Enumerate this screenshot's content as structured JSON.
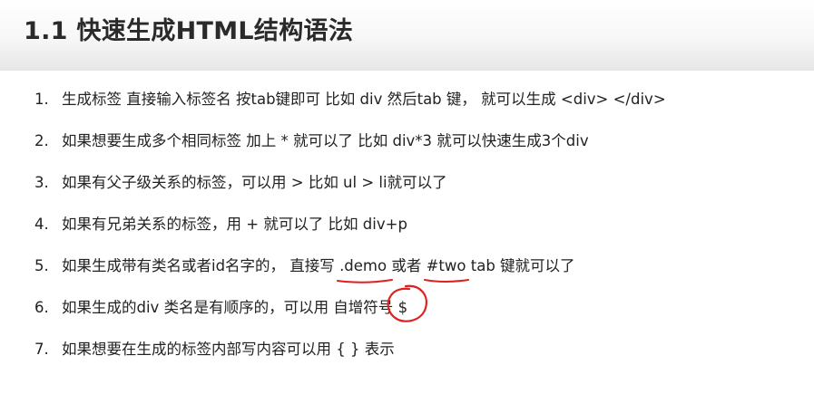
{
  "title": "1.1 快速生成HTML结构语法",
  "items": [
    {
      "num": "1.",
      "text": "生成标签 直接输入标签名 按tab键即可   比如  div   然后tab 键， 就可以生成 <div> </div>"
    },
    {
      "num": "2.",
      "text": "如果想要生成多个相同标签  加上 * 就可以了 比如   div*3  就可以快速生成3个div"
    },
    {
      "num": "3.",
      "text": "如果有父子级关系的标签，可以用 >  比如   ul > li就可以了"
    },
    {
      "num": "4.",
      "text": "如果有兄弟关系的标签，用  +  就可以了 比如 div+p"
    },
    {
      "num": "5.",
      "text_before": "如果生成带有类名或者id名字的，  直接写 ",
      "mark1": ".demo",
      "text_middle": "  或者  ",
      "mark2": "#two",
      "text_after": "  tab 键就可以了"
    },
    {
      "num": "6.",
      "text_before": "如果生成的div 类名是有顺序的，可以用 自增符号 ",
      "mark": "$"
    },
    {
      "num": "7.",
      "text": "如果想要在生成的标签内部写内容可以用 { }  表示"
    }
  ],
  "annotation_color": "#e0201c"
}
